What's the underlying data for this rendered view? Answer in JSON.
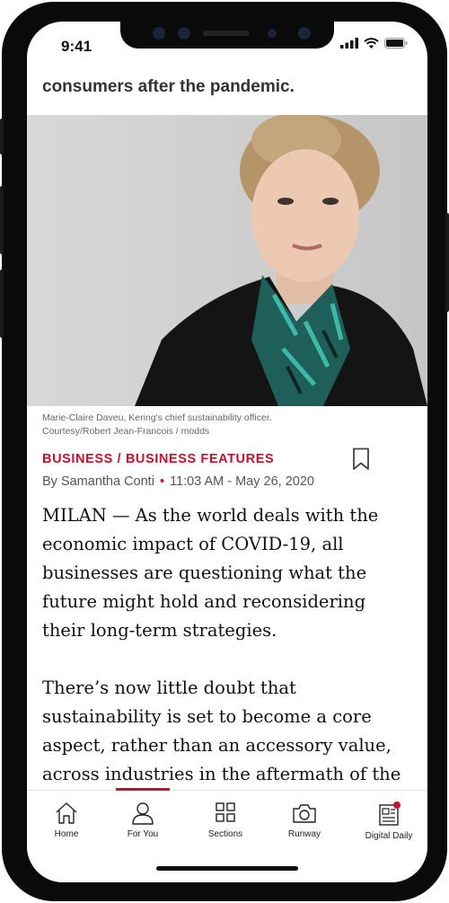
{
  "status_bar": {
    "time": "9:41"
  },
  "article": {
    "lead_fragment": "consumers after the pandemic.",
    "photo_caption_line1": "Marie-Claire Daveu, Kering's chief sustainability officer.",
    "photo_caption_line2": "Courtesy/Robert Jean-Francois / modds",
    "category": "BUSINESS / BUSINESS FEATURES",
    "author": "By Samantha Conti",
    "timestamp": "11:03 AM - May 26, 2020",
    "paragraph1": "MILAN — As the world deals with the economic impact of COVID-19, all businesses are questioning what the future might hold and reconsidering their long-term strategies.",
    "paragraph2": "There’s now little doubt that sustainability is set to become a core aspect, rather than an accessory value, across industries in the aftermath of the health crisis, which has"
  },
  "tabbar": {
    "tabs": [
      {
        "label": "Home",
        "icon": "home-icon"
      },
      {
        "label": "For You",
        "icon": "person-icon"
      },
      {
        "label": "Sections",
        "icon": "grid-icon"
      },
      {
        "label": "Runway",
        "icon": "camera-icon"
      },
      {
        "label": "Digital Daily",
        "icon": "newspaper-icon"
      }
    ],
    "active_index": 1
  },
  "colors": {
    "accent": "#c8102e",
    "text": "#111111",
    "muted": "#666666"
  }
}
